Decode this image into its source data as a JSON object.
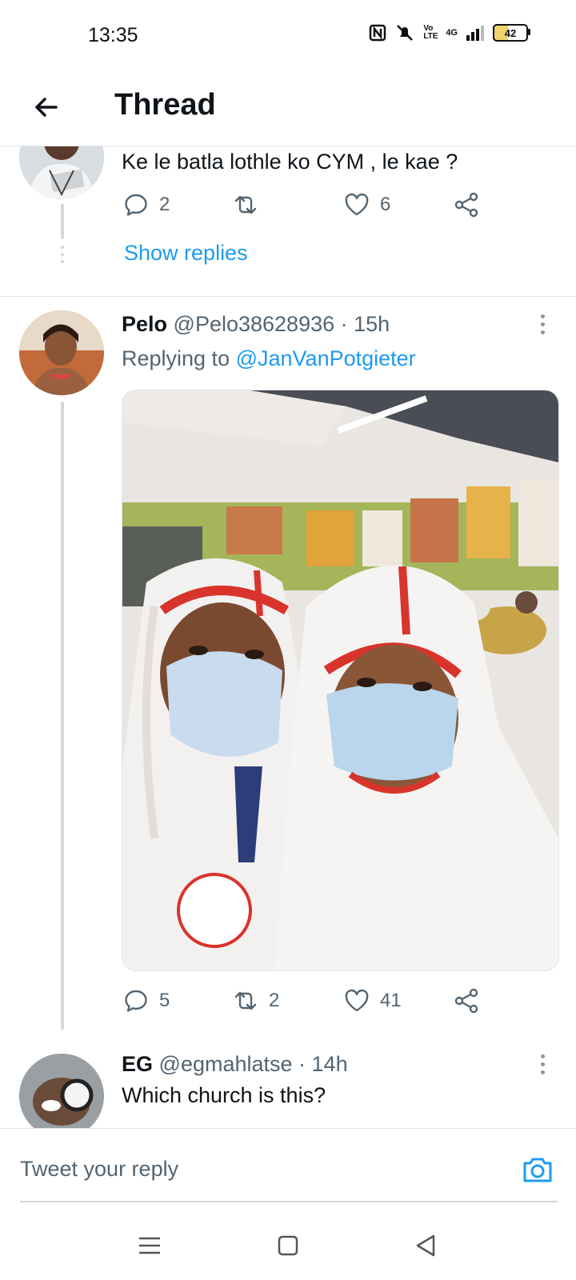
{
  "status_bar": {
    "time": "13:35",
    "network": "4G",
    "volte": "Vo LTE",
    "battery": "42"
  },
  "header": {
    "title": "Thread"
  },
  "tweet_top": {
    "text": "Ke le batla lothle ko CYM , le kae ?",
    "reply_count": "2",
    "retweet_count": "",
    "like_count": "6",
    "show_replies": "Show replies"
  },
  "tweet_pelo": {
    "name": "Pelo",
    "handle": "@Pelo38628936",
    "time": "· 15h",
    "replying_label": "Replying to",
    "replying_handle": "@JanVanPotgieter",
    "reply_count": "5",
    "retweet_count": "2",
    "like_count": "41"
  },
  "tweet_eg": {
    "name": "EG",
    "handle": "@egmahlatse",
    "time": "· 14h",
    "text": "Which church is this?"
  },
  "composer": {
    "placeholder": "Tweet your reply"
  },
  "colors": {
    "accent": "#1d9bf0",
    "secondary_text": "#536471",
    "thread_line": "#cfd9de"
  }
}
